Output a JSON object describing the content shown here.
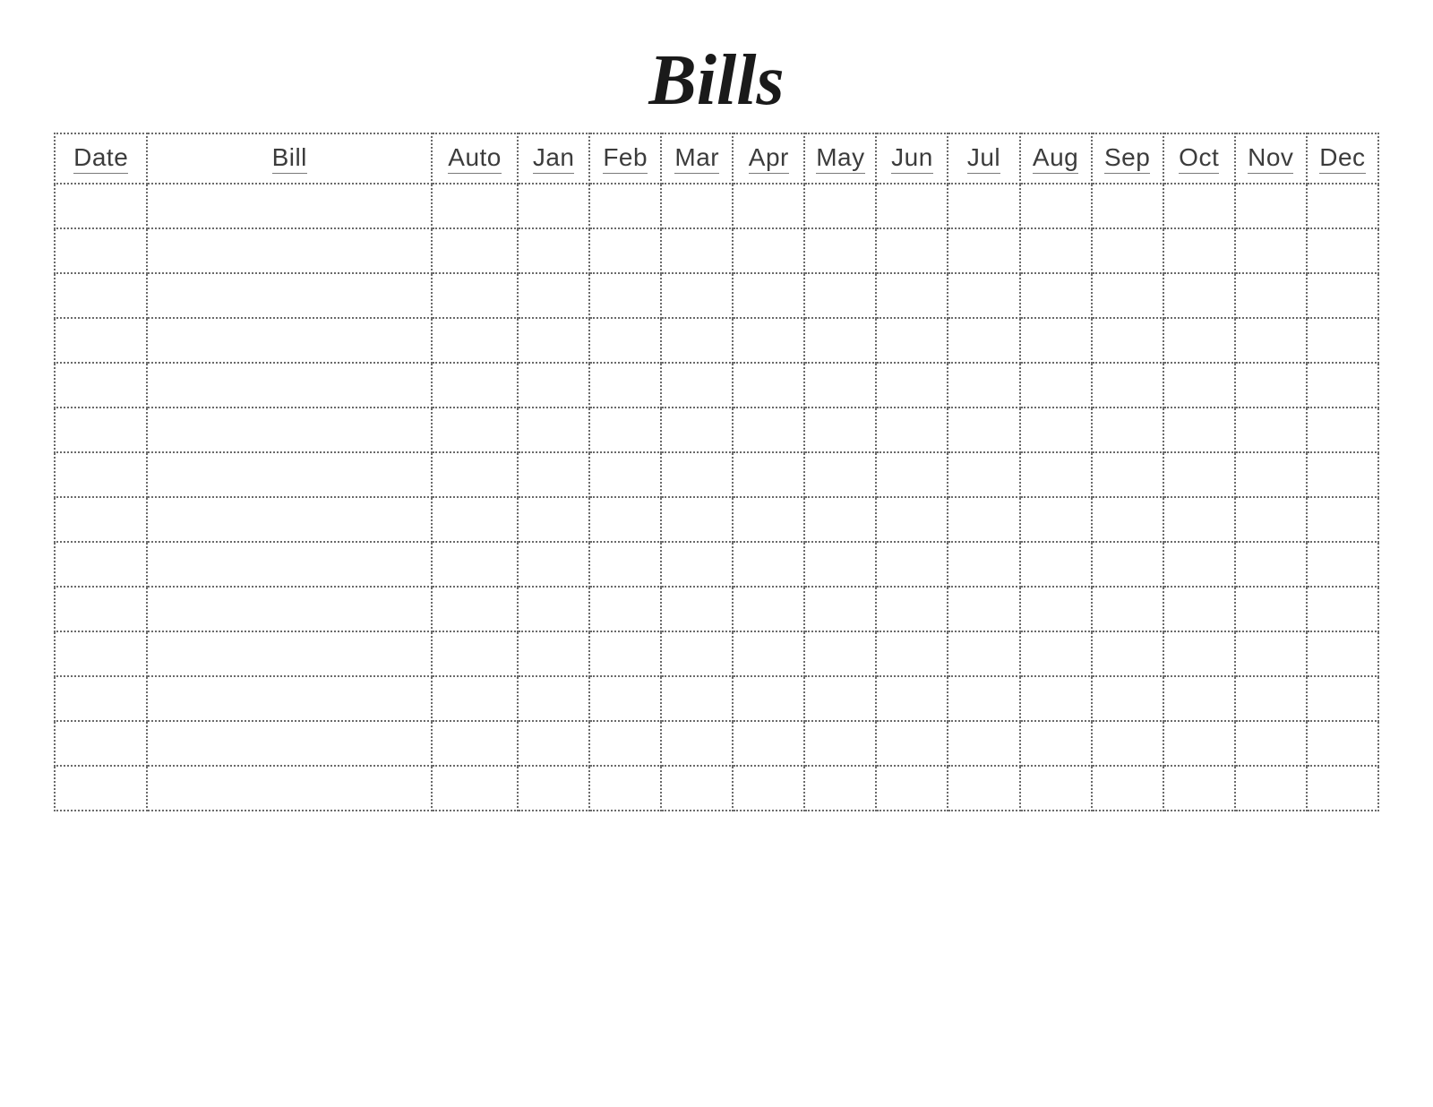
{
  "title": "Bills",
  "table": {
    "headers": [
      "Date",
      "Bill",
      "Auto",
      "Jan",
      "Feb",
      "Mar",
      "Apr",
      "May",
      "Jun",
      "Jul",
      "Aug",
      "Sep",
      "Oct",
      "Nov",
      "Dec"
    ],
    "row_count": 14
  }
}
